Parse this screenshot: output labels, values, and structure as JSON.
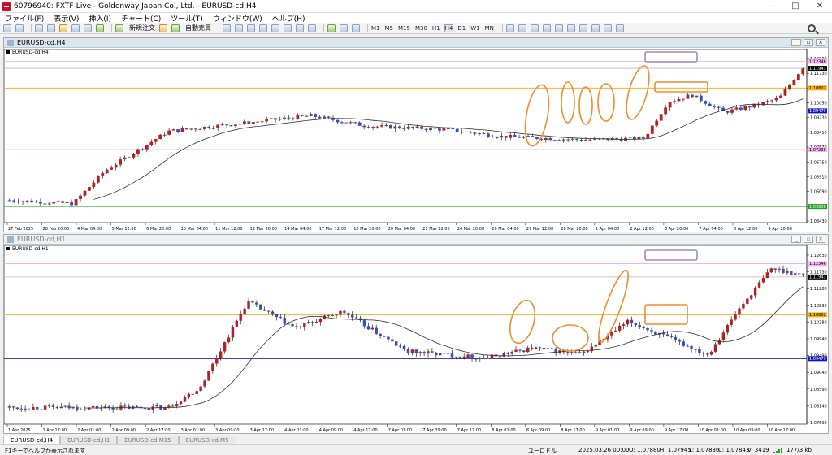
{
  "window": {
    "title": "60796940: FXTF-Live - Goldenway Japan Co., Ltd. - EURUSD-cd,H4",
    "buttons": [
      "—",
      "□",
      "✕"
    ]
  },
  "menu": [
    "ファイル(F)",
    "表示(V)",
    "挿入(I)",
    "チャート(C)",
    "ツール(T)",
    "ウィンドウ(W)",
    "ヘルプ(H)"
  ],
  "toolbar": {
    "new_order": "新規注文",
    "auto_trade": "自動売買",
    "timeframes": [
      "M1",
      "M5",
      "M15",
      "M30",
      "H1",
      "H4",
      "D1",
      "W1",
      "MN"
    ],
    "selected_timeframe": "H4",
    "icons": [
      "new-chart-icon",
      "profiles-icon",
      "market-watch-icon",
      "data-window-icon",
      "navigator-icon",
      "terminal-icon",
      "tester-icon",
      "options-icon",
      "zoom-in-icon",
      "zoom-out-icon",
      "tile-icon",
      "autoscroll-icon",
      "chart-shift-icon",
      "indicators-icon",
      "period-icon",
      "templates-icon",
      "cursor-icon",
      "crosshair-icon",
      "vline-icon",
      "hline-icon",
      "trendline-icon",
      "channel-icon",
      "fibo-icon",
      "text-icon",
      "label-icon",
      "arrows-icon",
      "search-icon"
    ]
  },
  "charts": [
    {
      "window_title": "EURUSD-cd,H4",
      "symbol_label": "EURUSD-cd,H4",
      "y_ticks": [
        "1.12550",
        "1.11730",
        "1.10880",
        "1.10050",
        "1.09230",
        "1.08410",
        "1.07570",
        "1.06750",
        "1.05910",
        "1.05090",
        "1.04250",
        "1.03430"
      ],
      "x_ticks": [
        "27 Feb 2025",
        "28 Feb 20:00",
        "4 Mar 04:00",
        "5 Mar 12:00",
        "6 Mar 20:00",
        "10 Mar 04:00",
        "11 Mar 12:00",
        "12 Mar 20:00",
        "14 Mar 04:00",
        "17 Mar 12:00",
        "18 Mar 20:00",
        "20 Mar 04:00",
        "21 Mar 12:00",
        "24 Mar 20:00",
        "26 Mar 04:00",
        "27 Mar 12:00",
        "28 Mar 20:00",
        "1 Apr 04:00",
        "2 Apr 12:00",
        "3 Apr 20:00",
        "7 Apr 04:00",
        "8 Apr 12:00",
        "9 Apr 20:00"
      ],
      "price_labels": [
        {
          "text": "1.12346",
          "color": "#f7b2f2"
        },
        {
          "text": "1.11943",
          "color": "#000000"
        },
        {
          "text": "1.10802",
          "color": "#ffb000"
        },
        {
          "text": "1.09479",
          "color": "#1010c8"
        },
        {
          "text": "1.07238",
          "color": "#f7b2f2"
        },
        {
          "text": "1.03936",
          "color": "#22a022"
        }
      ],
      "hlines": [
        {
          "price": 1.12346,
          "color": "#f0a8ee"
        },
        {
          "price": 1.11943,
          "color": "#b8b8b8"
        },
        {
          "price": 1.10802,
          "color": "#ffa200"
        },
        {
          "price": 1.09479,
          "color": "#0000c0"
        },
        {
          "price": 1.07238,
          "color": "#f0a8ee"
        },
        {
          "price": 1.03936,
          "color": "#00a000"
        }
      ]
    },
    {
      "window_title": "EURUSD-cd,H1",
      "symbol_label": "EURUSD-cd,H1",
      "y_ticks": [
        "1.12630",
        "1.11730",
        "1.11280",
        "1.10830",
        "1.10380",
        "1.09940",
        "1.09490",
        "1.09040",
        "1.08590",
        "1.08140",
        "1.07690"
      ],
      "x_ticks": [
        "1 Apr 2025",
        "1 Apr 17:00",
        "2 Apr 01:00",
        "2 Apr 09:00",
        "2 Apr 17:00",
        "3 Apr 01:00",
        "3 Apr 09:00",
        "3 Apr 17:00",
        "4 Apr 01:00",
        "4 Apr 09:00",
        "4 Apr 17:00",
        "7 Apr 01:00",
        "7 Apr 09:00",
        "7 Apr 17:00",
        "8 Apr 01:00",
        "8 Apr 09:00",
        "8 Apr 17:00",
        "9 Apr 01:00",
        "9 Apr 09:00",
        "9 Apr 17:00",
        "10 Apr 01:00",
        "10 Apr 09:00",
        "10 Apr 17:00"
      ],
      "price_labels": [
        {
          "text": "1.12346",
          "color": "#f7b2f2"
        },
        {
          "text": "1.11943",
          "color": "#000000"
        },
        {
          "text": "1.10802",
          "color": "#ffb000"
        },
        {
          "text": "1.09479",
          "color": "#1010c8"
        }
      ],
      "hlines": [
        {
          "price": 1.12346,
          "color": "#f0a8ee"
        },
        {
          "price": 1.11943,
          "color": "#b8b8b8"
        },
        {
          "price": 1.10802,
          "color": "#ffa200"
        },
        {
          "price": 1.09479,
          "color": "#0000c0"
        }
      ]
    }
  ],
  "tabs": [
    "EURUSD-cd,H4",
    "EURUSD-cd,H1",
    "EURUSD-cd,M15",
    "EURUSD-cd,M5"
  ],
  "active_tab": "EURUSD-cd,H4",
  "status": {
    "help": "F1キーでヘルプが表示されます",
    "profile": "ユーロドル",
    "datetime": "2025.03.26 00:00",
    "open": "O: 1.07880",
    "high": "H: 1.07945",
    "low": "L: 1.07836",
    "close": "C: 1.07843",
    "volume": "V: 3419",
    "traffic": "177/3 kb"
  },
  "colors": {
    "bull": "#b22222",
    "bear": "#3050c0",
    "ma": "#303030",
    "annotation": "#f08c30",
    "box_purple": "#a08cc0"
  }
}
